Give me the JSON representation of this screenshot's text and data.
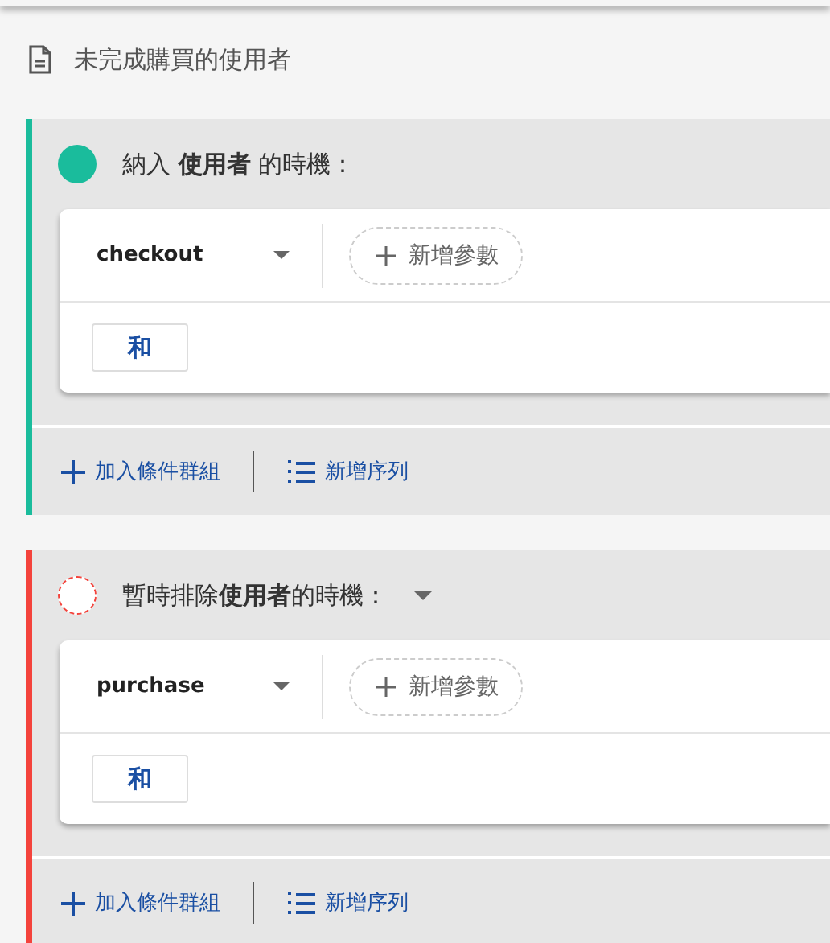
{
  "title": "未完成購買的使用者",
  "sections": [
    {
      "kind": "include",
      "color": "#1abc9c",
      "heading": "納入 **使用者** 的時機：",
      "dropdown": false,
      "event": "checkout",
      "add_param": "新增參數",
      "operator": "和",
      "footer": {
        "add_group": "加入條件群組",
        "add_sequence": "新增序列"
      }
    },
    {
      "kind": "exclude",
      "color": "#f4433c",
      "heading": "暫時排除**使用者**的時機：",
      "dropdown": true,
      "event": "purchase",
      "add_param": "新增參數",
      "operator": "和",
      "footer": {
        "add_group": "加入條件群組",
        "add_sequence": "新增序列"
      }
    }
  ]
}
